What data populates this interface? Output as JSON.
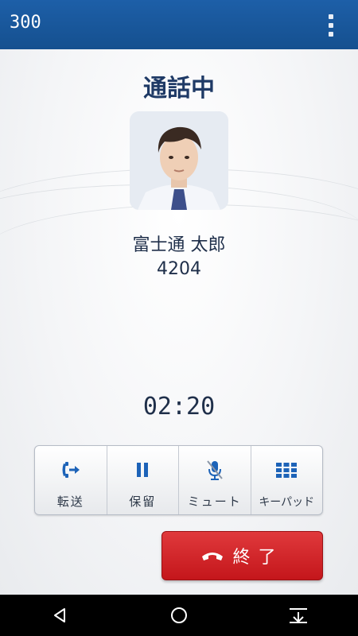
{
  "header": {
    "extension": "300",
    "menu_icon": "overflow-menu-icon"
  },
  "call": {
    "status": "通話中",
    "caller_name": "富士通 太郎",
    "caller_number": "4204",
    "duration": "02:20"
  },
  "actions": [
    {
      "label": "転送",
      "icon": "call-transfer-icon"
    },
    {
      "label": "保留",
      "icon": "pause-icon"
    },
    {
      "label": "ミュート",
      "icon": "mic-mute-icon"
    },
    {
      "label": "キーパッド",
      "icon": "keypad-icon"
    }
  ],
  "end_call": {
    "label": "終了",
    "icon": "hang-up-icon",
    "color": "#d42a2e"
  },
  "colors": {
    "header": "#1d5fa8",
    "accent": "#1d63b8",
    "end": "#d42a2e"
  }
}
